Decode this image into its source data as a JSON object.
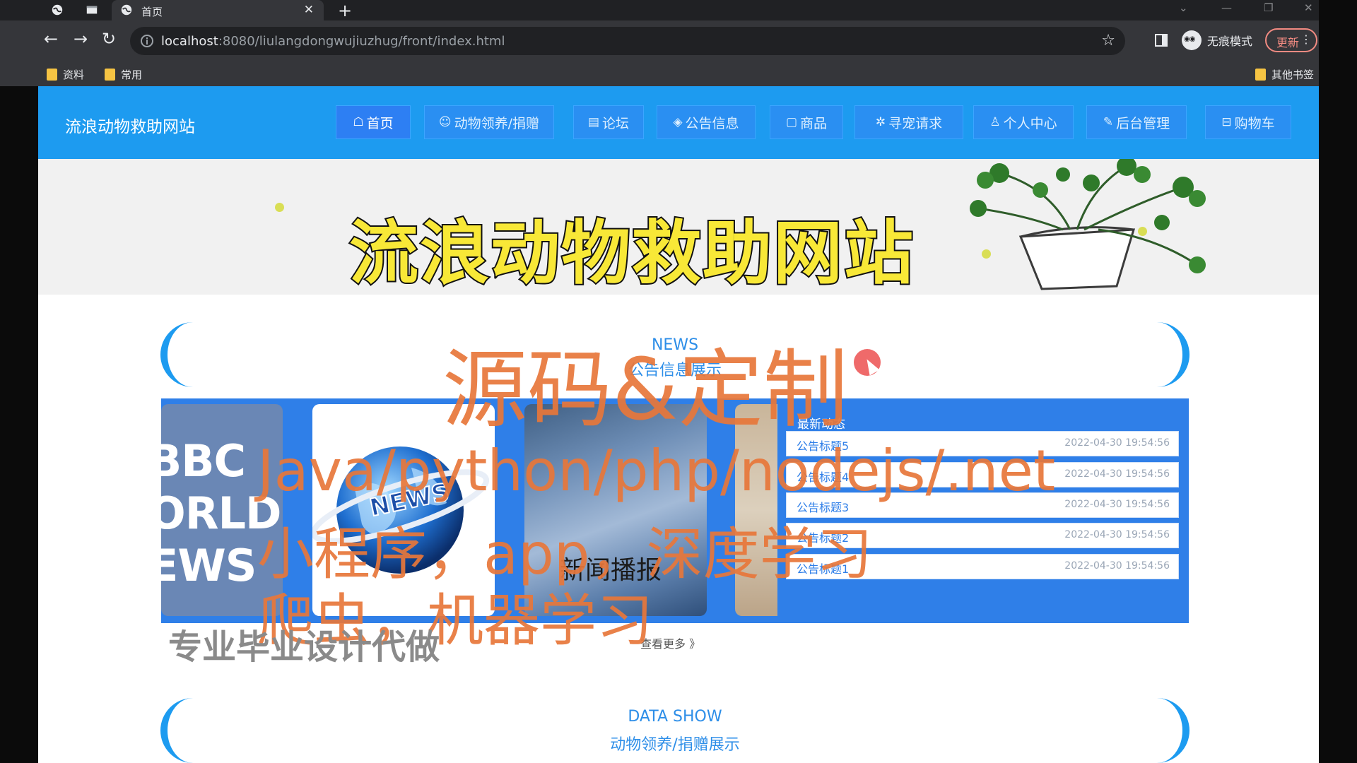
{
  "browser": {
    "tab_title": "首页",
    "url_host": "localhost",
    "url_rest": ":8080/liulangdongwujiuzhug/front/index.html",
    "incognito_label": "无痕模式",
    "update_label": "更新",
    "bookmarks": [
      "资料",
      "常用"
    ],
    "other_bookmarks": "其他书签"
  },
  "site": {
    "title": "流浪动物救助网站",
    "nav": [
      {
        "icon": "☖",
        "label": "首页"
      },
      {
        "icon": "☺",
        "label": "动物领养/捐赠"
      },
      {
        "icon": "▤",
        "label": "论坛"
      },
      {
        "icon": "◈",
        "label": "公告信息"
      },
      {
        "icon": "▢",
        "label": "商品"
      },
      {
        "icon": "✲",
        "label": "寻宠请求"
      },
      {
        "icon": "♙",
        "label": "个人中心"
      },
      {
        "icon": "✎",
        "label": "后台管理"
      },
      {
        "icon": "⊟",
        "label": "购物车"
      }
    ]
  },
  "banner_title": "流浪动物救助网站",
  "news_section": {
    "en": "NEWS",
    "cn": "公告信息展示"
  },
  "slides": {
    "bbc_lines": [
      "BBC",
      "ORLD",
      "EWS"
    ],
    "globe_label": "NEWS",
    "sky_label": "新闻播报"
  },
  "latest": {
    "title": "最新动态",
    "items": [
      {
        "title": "公告标题5",
        "date": "2022-04-30 19:54:56"
      },
      {
        "title": "公告标题4",
        "date": "2022-04-30 19:54:56"
      },
      {
        "title": "公告标题3",
        "date": "2022-04-30 19:54:56"
      },
      {
        "title": "公告标题2",
        "date": "2022-04-30 19:54:56"
      },
      {
        "title": "公告标题1",
        "date": "2022-04-30 19:54:56"
      }
    ]
  },
  "more_label": "查看更多 》",
  "data_section": {
    "en": "DATA SHOW",
    "cn": "动物领养/捐赠展示"
  },
  "overlay": {
    "line1": "源码&定制",
    "line2": "Java/python/php/nodejs/.net",
    "line3": "小程序，app，深度学习",
    "line4": "爬虫，机器学习",
    "gray": "专业毕业设计代做"
  },
  "colors": {
    "header_blue": "#1d9bf0",
    "news_blue": "#2f7fe8",
    "overlay_orange": "#e8773a",
    "title_yellow": "#f8e837"
  }
}
